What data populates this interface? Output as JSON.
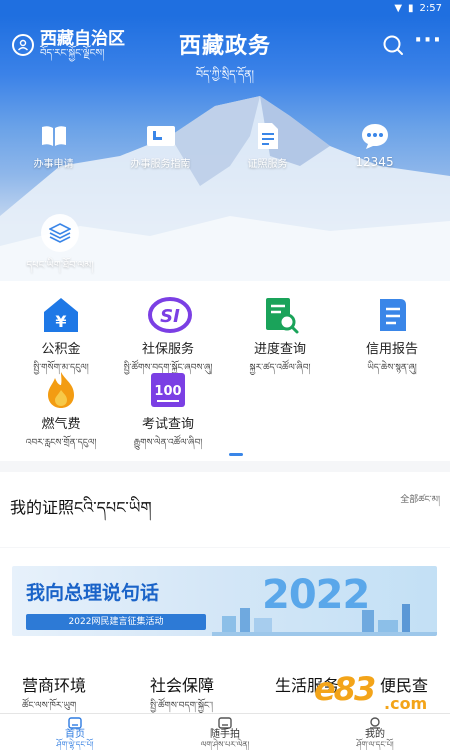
{
  "status_bar": {
    "time": "2:57"
  },
  "header": {
    "region_cn": "西藏自治区",
    "region_tb": "བོད་རང་སྐྱོང་ལྗོངས།",
    "title_cn": "西藏政务",
    "title_tb": "བོད་ཀྱི་སྲིད་དོན།",
    "search_icon": "search-icon",
    "more_icon": "more-icon"
  },
  "hero_services": [
    {
      "label": "办事申请",
      "icon": "book-icon"
    },
    {
      "label": "办事服务指南",
      "icon": "card-icon"
    },
    {
      "label": "证照服务",
      "icon": "document-icon"
    },
    {
      "label": "12345",
      "icon": "chat-icon"
    }
  ],
  "hero_service_extra": {
    "label": "དཔང་ཡིག་ཐོབ་ལམ།",
    "icon": "layers-icon"
  },
  "grid": [
    {
      "cn": "公积金",
      "tb": "སྤྱི་གསོག་མ་དངུལ།",
      "icon": "housing-fund-icon",
      "color": "#1e78e6"
    },
    {
      "cn": "社保服务",
      "tb": "སྤྱི་ཚོགས་བདག་སྐྱོང་ཞབས་ཞུ།",
      "icon": "social-security-icon",
      "color": "#7b3fe4"
    },
    {
      "cn": "进度查询",
      "tb": "སྐྱར་ཚད་འཚོལ་ཞིབ།",
      "icon": "progress-search-icon",
      "color": "#1aa35a"
    },
    {
      "cn": "信用报告",
      "tb": "ཡིད་ཆེས་སྙན་ཞུ།",
      "icon": "credit-report-icon",
      "color": "#3a86e8"
    },
    {
      "cn": "燃气费",
      "tb": "འབར་རླངས་གྲོན་དངུལ།",
      "icon": "gas-flame-icon",
      "color": "#f39c12"
    },
    {
      "cn": "考试查询",
      "tb": "རྒྱུགས་ལེན་འཚོལ་ཞིབ།",
      "icon": "exam-score-icon",
      "color": "#7b3fe4"
    }
  ],
  "certificates": {
    "title": "我的证照ངའི་དཔང་ཡིག",
    "all_label": "全部ཚང་མ།"
  },
  "banner": {
    "title": "我向总理说句话",
    "year": "2022",
    "subtitle": "2022网民建言征集活动"
  },
  "categories": [
    {
      "cn": "营商环境",
      "tb": "ཚོང་ལས་ཁོར་ཡུག"
    },
    {
      "cn": "社会保障",
      "tb": "སྤྱི་ཚོགས་བདག་སྐྱོང་།"
    },
    {
      "cn": "生活服务",
      "tb": ""
    },
    {
      "cn": "便民查",
      "tb": ""
    }
  ],
  "watermark": {
    "logo": "e83",
    "site": ".com 手游网"
  },
  "bottom_nav": [
    {
      "cn": "首页",
      "tb": "ཤོག་ལྷེ་དང་པོ།",
      "icon": "home-icon",
      "active": true
    },
    {
      "cn": "随手拍",
      "tb": "ལག་ཤེས་པར་ལེན།",
      "icon": "camera-icon",
      "active": false
    },
    {
      "cn": "我的",
      "tb": "ཤོག་ལ་དང་པོ།",
      "icon": "user-icon",
      "active": false
    }
  ],
  "colors": {
    "primary": "#1f6fe0",
    "accent": "#3a86e8"
  }
}
